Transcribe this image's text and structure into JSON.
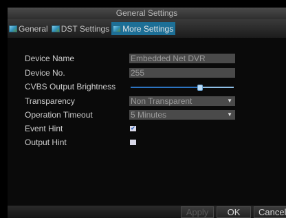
{
  "window": {
    "title": "General Settings"
  },
  "tabs": [
    {
      "label": "General",
      "icon": "settings-tab-icon",
      "active": false
    },
    {
      "label": "DST Settings",
      "icon": "settings-tab-icon",
      "active": false
    },
    {
      "label": "More Settings",
      "icon": "settings-tab-icon",
      "active": true
    }
  ],
  "form": {
    "device_name": {
      "label": "Device Name",
      "value": "Embedded Net DVR"
    },
    "device_no": {
      "label": "Device No.",
      "value": "255"
    },
    "cvbs_brightness": {
      "label": "CVBS Output Brightness",
      "level_fraction": 0.67
    },
    "transparency": {
      "label": "Transparency",
      "value": "Non Transparent"
    },
    "operation_timeout": {
      "label": "Operation Timeout",
      "value": "5 Minutes"
    },
    "event_hint": {
      "label": "Event Hint",
      "checked": true
    },
    "output_hint": {
      "label": "Output Hint",
      "checked": false
    }
  },
  "footer": {
    "apply_label": "Apply",
    "ok_label": "OK",
    "cancel_label": "Cancel"
  },
  "colors": {
    "active_tab": "#1d6f96",
    "slider_fill": "#2c74c2",
    "checkbox_mark": "#3e6fc2"
  }
}
